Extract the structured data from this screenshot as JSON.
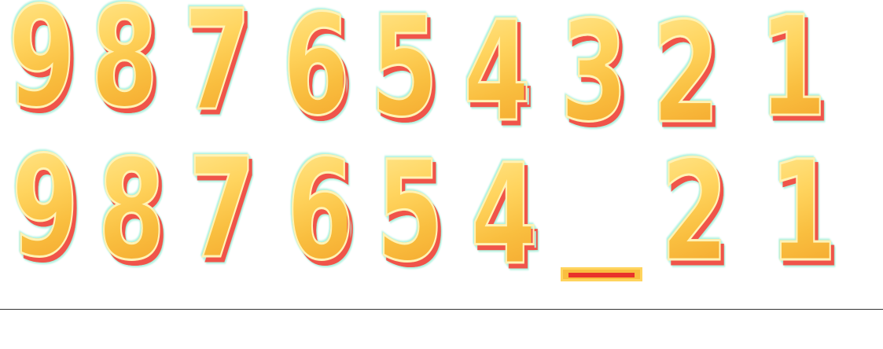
{
  "puzzle": {
    "sequence_row": {
      "digits": [
        "9",
        "8",
        "7",
        "6",
        "5",
        "4",
        "3",
        "2",
        "1"
      ]
    },
    "incomplete_row": {
      "digits_before_blank": [
        "9",
        "8",
        "7",
        "6",
        "5",
        "4"
      ],
      "digits_after_blank": [
        "2",
        "1"
      ],
      "blank_glyph": "_"
    }
  },
  "colors": {
    "digit_fill": "#f9be3f",
    "digit_highlight": "#ffe58a",
    "digit_shadow": "#f0544a",
    "digit_glow": "#aef2df",
    "blank_fill": "#f9be3f",
    "blank_inner": "#e9332b",
    "divider": "#333333",
    "background": "#ffffff"
  }
}
